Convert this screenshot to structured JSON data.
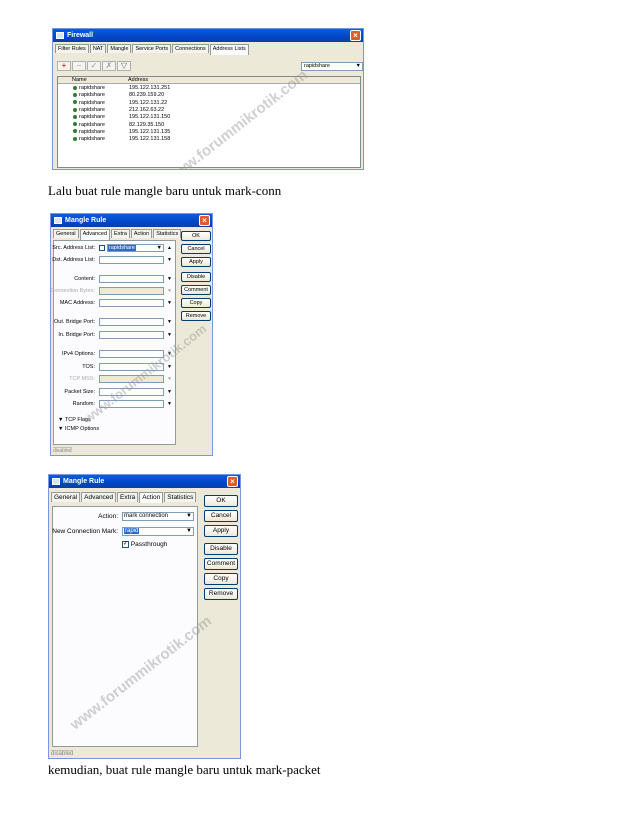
{
  "firewall": {
    "title": "Firewall",
    "tabs": [
      "Filter Rules",
      "NAT",
      "Mangle",
      "Service Ports",
      "Connections",
      "Address Lists"
    ],
    "active_tab": "Address Lists",
    "filter_value": "rapidshare",
    "columns": [
      "Name",
      "Address"
    ],
    "rows": [
      {
        "name": "rapidshare",
        "address": "195.122.131.251"
      },
      {
        "name": "rapidshare",
        "address": "80.239.159.20"
      },
      {
        "name": "rapidshare",
        "address": "195.122.131.22"
      },
      {
        "name": "rapidshare",
        "address": "212.162.63.22"
      },
      {
        "name": "rapidshare",
        "address": "195.122.131.150"
      },
      {
        "name": "rapidshare",
        "address": "82.129.35.150"
      },
      {
        "name": "rapidshare",
        "address": "195.122.131.135"
      },
      {
        "name": "rapidshare",
        "address": "195.122.131.158"
      }
    ],
    "watermark": "www.forummikrotik.com"
  },
  "caption1": "Lalu buat rule mangle baru untuk mark-conn",
  "mangle1": {
    "title": "Mangle Rule",
    "tabs": [
      "General",
      "Advanced",
      "Extra",
      "Action",
      "Statistics"
    ],
    "active_tab": "Advanced",
    "fields": {
      "src_address_list_label": "Src. Address List:",
      "src_address_list_value": "rapidshare",
      "dst_address_list_label": "Dst. Address List:",
      "content_label": "Content:",
      "connection_bytes_label": "Connection Bytes:",
      "mac_address_label": "MAC Address:",
      "out_bridge_port_label": "Out. Bridge Port:",
      "in_bridge_port_label": "In. Bridge Port:",
      "ipv4_options_label": "IPv4 Options:",
      "tos_label": "TOS:",
      "tcp_mss_label": "TCP MSS:",
      "packet_size_label": "Packet Size:",
      "random_label": "Random:"
    },
    "sections": [
      "TCP Flags",
      "ICMP Options"
    ],
    "buttons": [
      "OK",
      "Cancel",
      "Apply",
      "Disable",
      "Comment",
      "Copy",
      "Remove"
    ],
    "status": "disabled",
    "watermark": "www.forummikrotik.com"
  },
  "mangle2": {
    "title": "Mangle Rule",
    "tabs": [
      "General",
      "Advanced",
      "Extra",
      "Action",
      "Statistics"
    ],
    "active_tab": "Action",
    "action_label": "Action:",
    "action_value": "mark connection",
    "new_conn_mark_label": "New Connection Mark:",
    "new_conn_mark_value": "rapid",
    "passthrough_label": "Passthrough",
    "buttons": [
      "OK",
      "Cancel",
      "Apply",
      "Disable",
      "Comment",
      "Copy",
      "Remove"
    ],
    "status": "disabled",
    "watermark": "www.forummikrotik.com"
  },
  "caption2": "kemudian, buat rule mangle baru untuk mark-packet"
}
